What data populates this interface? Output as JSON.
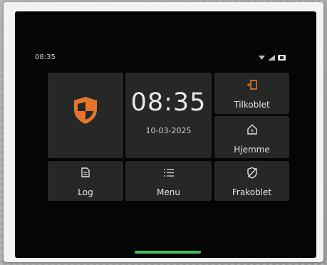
{
  "status_bar": {
    "time": "08:35",
    "icons": [
      "wifi-icon",
      "signal-icon",
      "battery-icon"
    ]
  },
  "security_tile": {
    "icon": "shield-icon",
    "accent_color": "#e8742a"
  },
  "clock": {
    "time": "08:35",
    "date": "10-03-2025"
  },
  "mode_buttons": [
    {
      "icon": "door-icon",
      "label": "Tilkoblet",
      "icon_color": "#e8742a"
    },
    {
      "icon": "home-icon",
      "label": "Hjemme"
    },
    {
      "icon": "shield-off-icon",
      "label": "Frakoblet"
    }
  ],
  "bottom_buttons": [
    {
      "icon": "log-icon",
      "label": "Log"
    },
    {
      "icon": "menu-icon",
      "label": "Menu"
    }
  ],
  "colors": {
    "tile_bg": "#262827",
    "screen_bg": "#050505",
    "home_indicator": "#3fbf5a"
  }
}
